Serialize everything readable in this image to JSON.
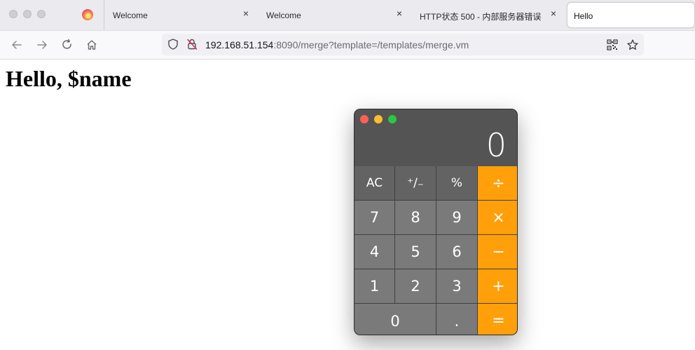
{
  "tabs": [
    {
      "title": "Welcome"
    },
    {
      "title": "Welcome"
    },
    {
      "title": "HTTP状态 500 - 内部服务器错误"
    },
    {
      "title": "Hello"
    }
  ],
  "address_bar": {
    "host": "192.168.51.154",
    "rest": ":8090/merge?template=/templates/merge.vm"
  },
  "page": {
    "heading": "Hello, $name"
  },
  "calculator": {
    "display": "0",
    "keys": {
      "ac": "AC",
      "sign": "⁺∕₋",
      "percent": "%",
      "divide": "÷",
      "seven": "7",
      "eight": "8",
      "nine": "9",
      "multiply": "×",
      "four": "4",
      "five": "5",
      "six": "6",
      "minus": "−",
      "one": "1",
      "two": "2",
      "three": "3",
      "plus": "+",
      "zero": "0",
      "decimal": ".",
      "equals": "="
    },
    "colors": {
      "operator": "#ff9f0a",
      "function": "#636363",
      "digit": "#7a7a7a",
      "close": "#ff5f57",
      "minimize": "#febc2e",
      "zoom": "#28c840"
    }
  }
}
